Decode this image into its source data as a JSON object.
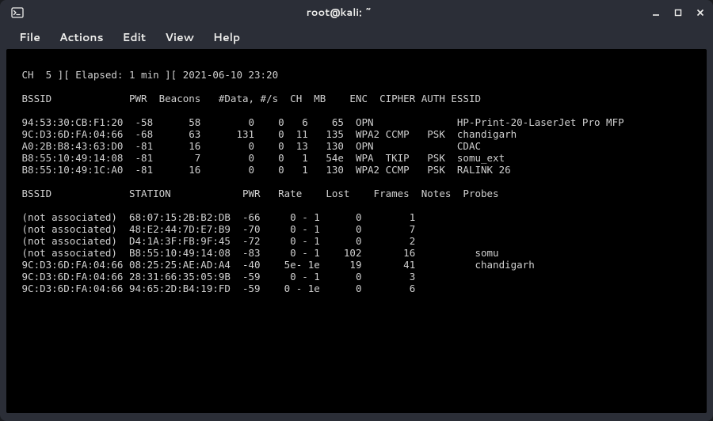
{
  "window": {
    "title": "root@kali: ~",
    "terminal_icon": "terminal-icon"
  },
  "menu": {
    "file": "File",
    "actions": "Actions",
    "edit": "Edit",
    "view": "View",
    "help": "Help"
  },
  "status_line": " CH  5 ][ Elapsed: 1 min ][ 2021-06-10 23:20",
  "ap_header": {
    "bssid": "BSSID",
    "pwr": "PWR",
    "beacons": "Beacons",
    "data": "#Data,",
    "ps": "#/s",
    "ch": "CH",
    "mb": "MB",
    "enc": "ENC",
    "cipher": "CIPHER",
    "auth": "AUTH",
    "essid": "ESSID"
  },
  "ap_rows": [
    {
      "bssid": "94:53:30:CB:F1:20",
      "pwr": "-58",
      "beacons": "58",
      "data": "0",
      "ps": "0",
      "ch": "6",
      "mb": "65",
      "enc": "OPN",
      "cipher": "",
      "auth": "",
      "essid": "HP-Print-20-LaserJet Pro MFP"
    },
    {
      "bssid": "9C:D3:6D:FA:04:66",
      "pwr": "-68",
      "beacons": "63",
      "data": "131",
      "ps": "0",
      "ch": "11",
      "mb": "135",
      "enc": "WPA2",
      "cipher": "CCMP",
      "auth": "PSK",
      "essid": "chandigarh"
    },
    {
      "bssid": "A0:2B:B8:43:63:D0",
      "pwr": "-81",
      "beacons": "16",
      "data": "0",
      "ps": "0",
      "ch": "13",
      "mb": "130",
      "enc": "OPN",
      "cipher": "",
      "auth": "",
      "essid": "CDAC"
    },
    {
      "bssid": "B8:55:10:49:14:08",
      "pwr": "-81",
      "beacons": "7",
      "data": "0",
      "ps": "0",
      "ch": "1",
      "mb": "54e",
      "enc": "WPA",
      "cipher": "TKIP",
      "auth": "PSK",
      "essid": "somu_ext"
    },
    {
      "bssid": "B8:55:10:49:1C:A0",
      "pwr": "-81",
      "beacons": "16",
      "data": "0",
      "ps": "0",
      "ch": "1",
      "mb": "130",
      "enc": "WPA2",
      "cipher": "CCMP",
      "auth": "PSK",
      "essid": "RALINK 26"
    }
  ],
  "sta_header": {
    "bssid": "BSSID",
    "station": "STATION",
    "pwr": "PWR",
    "rate": "Rate",
    "lost": "Lost",
    "frames": "Frames",
    "notes": "Notes",
    "probes": "Probes"
  },
  "sta_rows": [
    {
      "bssid": "(not associated)",
      "station": "68:07:15:2B:B2:DB",
      "pwr": "-66",
      "rate": "0 - 1",
      "lost": "0",
      "frames": "1",
      "notes": "",
      "probes": ""
    },
    {
      "bssid": "(not associated)",
      "station": "48:E2:44:7D:E7:B9",
      "pwr": "-70",
      "rate": "0 - 1",
      "lost": "0",
      "frames": "7",
      "notes": "",
      "probes": ""
    },
    {
      "bssid": "(not associated)",
      "station": "D4:1A:3F:FB:9F:45",
      "pwr": "-72",
      "rate": "0 - 1",
      "lost": "0",
      "frames": "2",
      "notes": "",
      "probes": ""
    },
    {
      "bssid": "(not associated)",
      "station": "B8:55:10:49:14:08",
      "pwr": "-83",
      "rate": "0 - 1",
      "lost": "102",
      "frames": "16",
      "notes": "",
      "probes": "somu"
    },
    {
      "bssid": "9C:D3:6D:FA:04:66",
      "station": "08:25:25:AE:AD:A4",
      "pwr": "-40",
      "rate": "5e- 1e",
      "lost": "19",
      "frames": "41",
      "notes": "",
      "probes": "chandigarh"
    },
    {
      "bssid": "9C:D3:6D:FA:04:66",
      "station": "28:31:66:35:05:9B",
      "pwr": "-59",
      "rate": "0 - 1",
      "lost": "0",
      "frames": "3",
      "notes": "",
      "probes": ""
    },
    {
      "bssid": "9C:D3:6D:FA:04:66",
      "station": "94:65:2D:B4:19:FD",
      "pwr": "-59",
      "rate": "0 - 1e",
      "lost": "0",
      "frames": "6",
      "notes": "",
      "probes": ""
    }
  ]
}
